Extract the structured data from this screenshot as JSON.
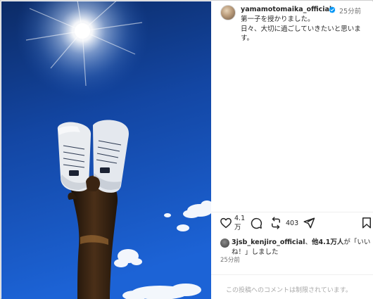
{
  "post": {
    "username": "yamamotomaika_official",
    "time_ago": "25分前",
    "caption_line1": "第一子を授かりました。",
    "caption_line2": "日々、大切に過ごしていきたいと思いま",
    "caption_line3": "す。"
  },
  "actions": {
    "likes_count_line1": "4.1",
    "likes_count_line2": "万",
    "reposts_count": "403"
  },
  "liked_by": {
    "user": "3jsb_kenjiro_official",
    "separator": "、",
    "others": "他4.1万人",
    "suffix": "が「いいね！」しました"
  },
  "timestamp": "25分前",
  "comments_notice": "この投稿へのコメントは制限されています。",
  "colors": {
    "sky_top": "#0e2f6c",
    "sky_bottom": "#1a5fcf",
    "verified_blue": "#0095f6",
    "muted_text": "#737373"
  },
  "icons": [
    "heart-icon",
    "comment-icon",
    "repost-icon",
    "share-icon",
    "bookmark-icon",
    "verified-badge-icon"
  ]
}
